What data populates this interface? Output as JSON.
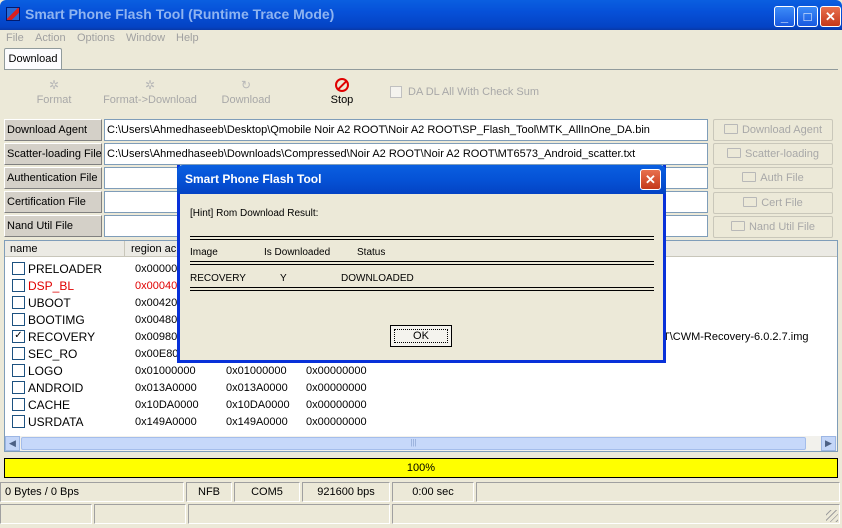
{
  "window": {
    "title": "Smart Phone Flash Tool (Runtime Trace Mode)"
  },
  "menu": [
    "File",
    "Action",
    "Options",
    "Window",
    "Help"
  ],
  "tabs": [
    "Download"
  ],
  "toolbar": {
    "format": "Format",
    "format_download": "Format->Download",
    "download": "Download",
    "stop": "Stop",
    "checksum": "DA DL All With Check Sum"
  },
  "files": [
    {
      "label": "Download Agent",
      "path": "C:\\Users\\Ahmedhaseeb\\Desktop\\Qmobile Noir A2 ROOT\\Noir A2 ROOT\\SP_Flash_Tool\\MTK_AllInOne_DA.bin",
      "button": "Download Agent"
    },
    {
      "label": "Scatter-loading File",
      "path": "C:\\Users\\Ahmedhaseeb\\Downloads\\Compressed\\Noir A2 ROOT\\Noir A2 ROOT\\MT6573_Android_scatter.txt",
      "button": "Scatter-loading"
    },
    {
      "label": "Authentication File",
      "path": "",
      "button": "Auth File"
    },
    {
      "label": "Certification File",
      "path": "",
      "button": "Cert File"
    },
    {
      "label": "Nand Util File",
      "path": "",
      "button": "Nand Util File"
    }
  ],
  "list": {
    "headers": [
      "name",
      "region ac"
    ],
    "rows": [
      {
        "checked": false,
        "red": false,
        "name": "PRELOADER",
        "c1": "0x000000",
        "c2": "",
        "c3": "",
        "path": ""
      },
      {
        "checked": false,
        "red": true,
        "name": "DSP_BL",
        "c1": "0x000400",
        "c2": "",
        "c3": "",
        "path": ""
      },
      {
        "checked": false,
        "red": false,
        "name": "UBOOT",
        "c1": "0x004200",
        "c2": "",
        "c3": "",
        "path": ""
      },
      {
        "checked": false,
        "red": false,
        "name": "BOOTIMG",
        "c1": "0x004800",
        "c2": "",
        "c3": "",
        "path": ""
      },
      {
        "checked": true,
        "red": false,
        "name": "RECOVERY",
        "c1": "0x009800",
        "c2": "",
        "c3": "",
        "path": "T\\CWM-Recovery-6.0.2.7.img"
      },
      {
        "checked": false,
        "red": false,
        "name": "SEC_RO",
        "c1": "0x00E800",
        "c2": "",
        "c3": "",
        "path": ""
      },
      {
        "checked": false,
        "red": false,
        "name": "LOGO",
        "c1": "0x01000000",
        "c2": "0x01000000",
        "c3": "0x00000000",
        "path": ""
      },
      {
        "checked": false,
        "red": false,
        "name": "ANDROID",
        "c1": "0x013A0000",
        "c2": "0x013A0000",
        "c3": "0x00000000",
        "path": ""
      },
      {
        "checked": false,
        "red": false,
        "name": "CACHE",
        "c1": "0x10DA0000",
        "c2": "0x10DA0000",
        "c3": "0x00000000",
        "path": ""
      },
      {
        "checked": false,
        "red": false,
        "name": "USRDATA",
        "c1": "0x149A0000",
        "c2": "0x149A0000",
        "c3": "0x00000000",
        "path": ""
      }
    ]
  },
  "progress": {
    "label": "100%",
    "fraction": 1.0,
    "color": "#FFFF00"
  },
  "status": {
    "bytes": "0 Bytes / 0 Bps",
    "type": "NFB",
    "port": "COM5",
    "baud": "921600 bps",
    "time": "0:00 sec"
  },
  "dialog": {
    "title": "Smart Phone Flash Tool",
    "hint": "[Hint] Rom Download Result:",
    "col_image": "Image",
    "col_downloaded": "Is Downloaded",
    "col_status": "Status",
    "row_image": "RECOVERY",
    "row_downloaded": "Y",
    "row_status": "DOWNLOADED",
    "ok": "OK"
  }
}
